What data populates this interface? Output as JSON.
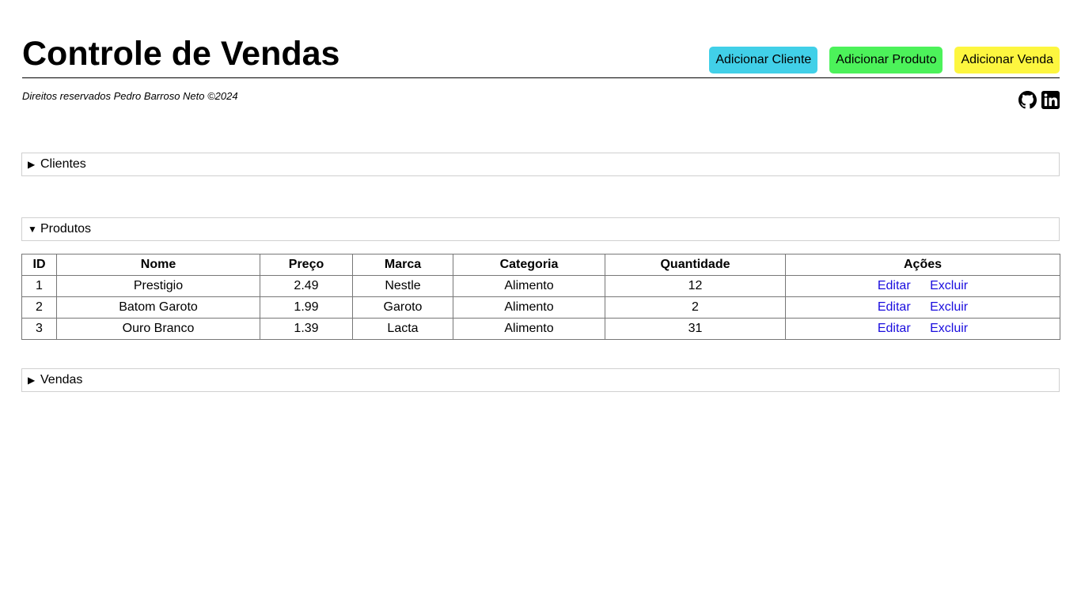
{
  "header": {
    "title": "Controle de Vendas",
    "buttons": [
      {
        "label": "Adicionar Cliente",
        "color": "#41d0e8"
      },
      {
        "label": "Adicionar Produto",
        "color": "#4cf25a"
      },
      {
        "label": "Adicionar Venda",
        "color": "#fdf63f"
      }
    ]
  },
  "footer": {
    "copyright": "Direitos reservados Pedro Barroso Neto ©2024",
    "social": [
      "github-icon",
      "linkedin-icon"
    ]
  },
  "sections": {
    "clientes": {
      "label": "Clientes",
      "marker": "▶",
      "expanded": false
    },
    "produtos": {
      "label": "Produtos",
      "marker": "▼",
      "expanded": true
    },
    "vendas": {
      "label": "Vendas",
      "marker": "▶",
      "expanded": false
    }
  },
  "products_table": {
    "headers": [
      "ID",
      "Nome",
      "Preço",
      "Marca",
      "Categoria",
      "Quantidade",
      "Ações"
    ],
    "rows": [
      {
        "id": "1",
        "nome": "Prestigio",
        "preco": "2.49",
        "marca": "Nestle",
        "categoria": "Alimento",
        "quantidade": "12",
        "edit": "Editar",
        "delete": "Excluir"
      },
      {
        "id": "2",
        "nome": "Batom Garoto",
        "preco": "1.99",
        "marca": "Garoto",
        "categoria": "Alimento",
        "quantidade": "2",
        "edit": "Editar",
        "delete": "Excluir"
      },
      {
        "id": "3",
        "nome": "Ouro Branco",
        "preco": "1.39",
        "marca": "Lacta",
        "categoria": "Alimento",
        "quantidade": "31",
        "edit": "Editar",
        "delete": "Excluir"
      }
    ]
  }
}
